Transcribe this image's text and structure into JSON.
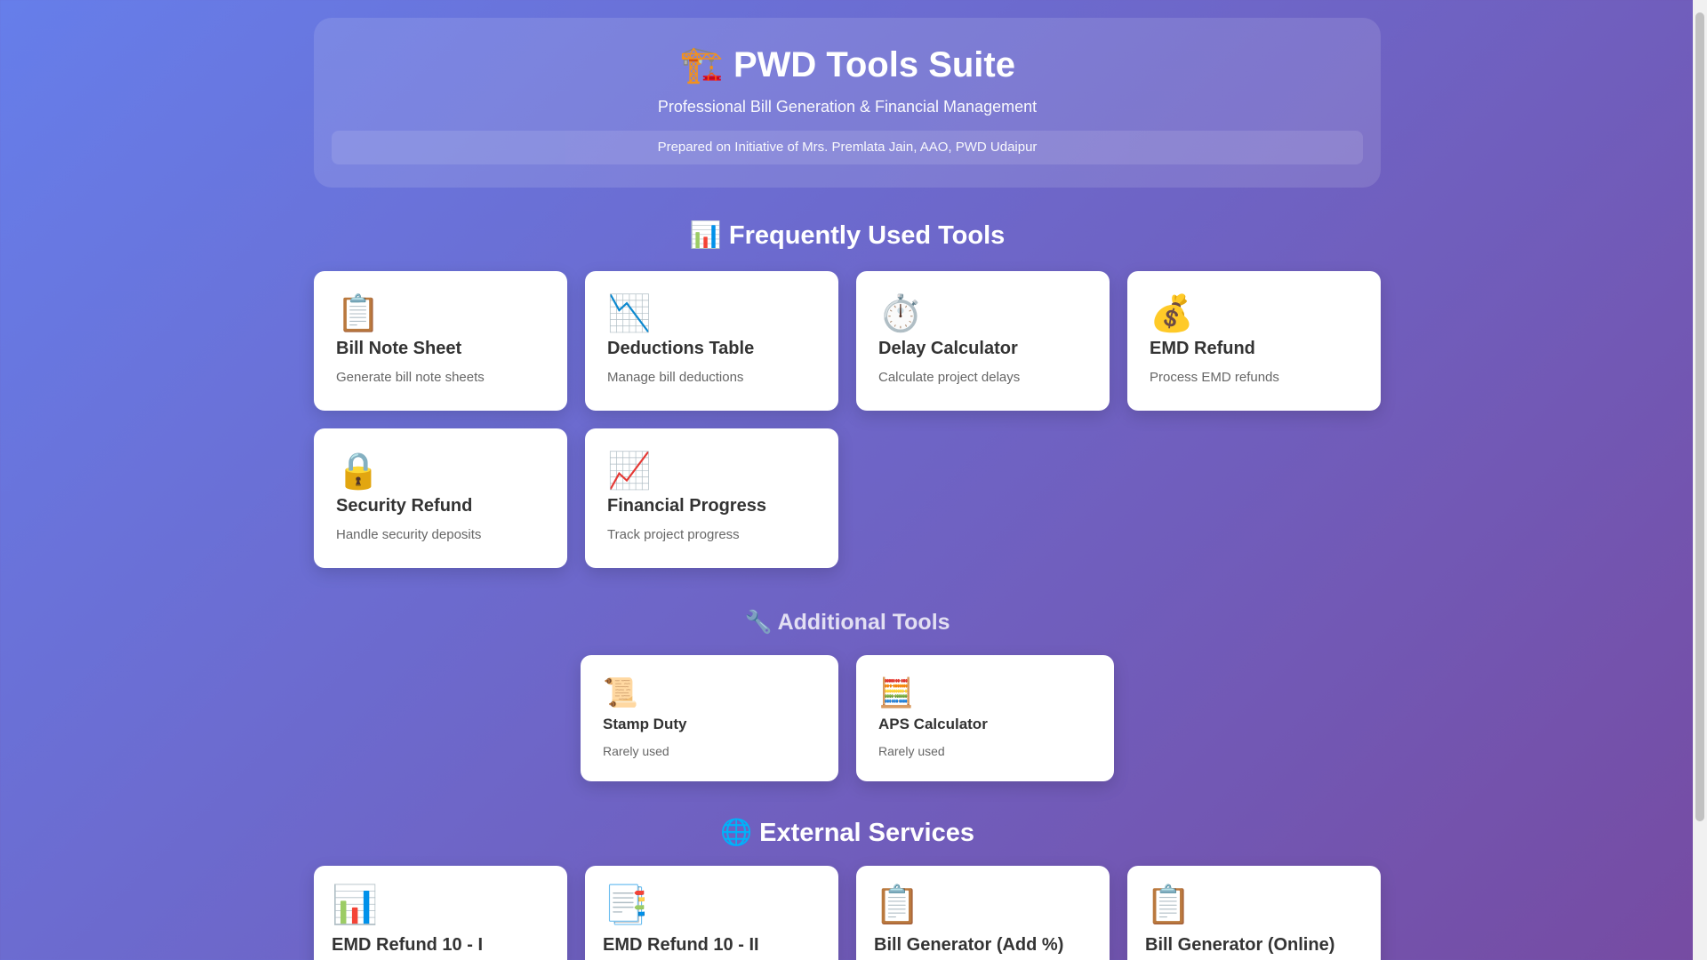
{
  "header": {
    "icon": "🏗️",
    "title": "PWD Tools Suite",
    "subtitle": "Professional Bill Generation & Financial Management",
    "prepared": "Prepared on Initiative of Mrs. Premlata Jain, AAO, PWD Udaipur"
  },
  "frequent": {
    "heading": "📊 Frequently Used Tools",
    "items": [
      {
        "icon": "📋",
        "title": "Bill Note Sheet",
        "desc": "Generate bill note sheets"
      },
      {
        "icon": "📉",
        "title": "Deductions Table",
        "desc": "Manage bill deductions"
      },
      {
        "icon": "⏱️",
        "title": "Delay Calculator",
        "desc": "Calculate project delays"
      },
      {
        "icon": "💰",
        "title": "EMD Refund",
        "desc": "Process EMD refunds"
      },
      {
        "icon": "🔒",
        "title": "Security Refund",
        "desc": "Handle security deposits"
      },
      {
        "icon": "📈",
        "title": "Financial Progress",
        "desc": "Track project progress"
      }
    ]
  },
  "additional": {
    "heading": "🔧 Additional Tools",
    "items": [
      {
        "icon": "📜",
        "title": "Stamp Duty",
        "desc": "Rarely used"
      },
      {
        "icon": "🧮",
        "title": "APS Calculator",
        "desc": "Rarely used"
      }
    ]
  },
  "external": {
    "heading": "🌐 External Services",
    "items": [
      {
        "icon": "📊",
        "title": "EMD Refund 10 - I"
      },
      {
        "icon": "📑",
        "title": "EMD Refund 10 - II"
      },
      {
        "icon": "📋",
        "title": "Bill Generator (Add %)"
      },
      {
        "icon": "📋",
        "title": "Bill Generator (Online)"
      }
    ]
  }
}
